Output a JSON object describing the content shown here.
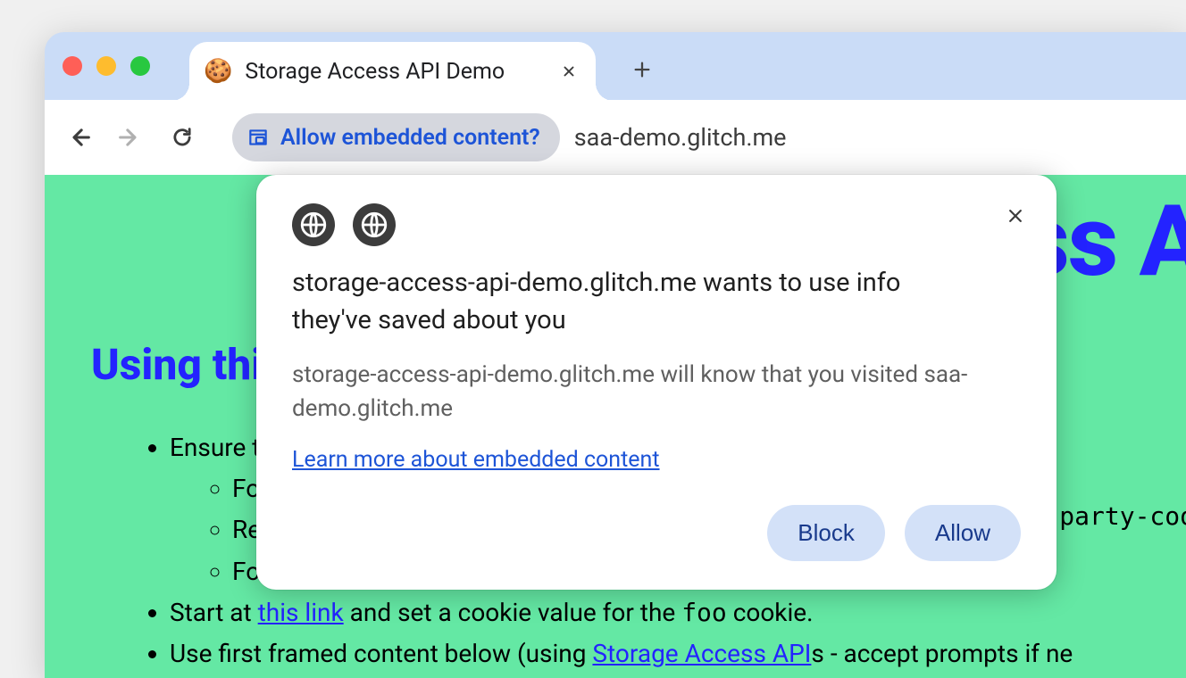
{
  "window": {
    "tab": {
      "favicon": "🍪",
      "title": "Storage Access API Demo"
    }
  },
  "toolbar": {
    "chip_label": "Allow embedded content?",
    "url": "saa-demo.glitch.me"
  },
  "page": {
    "hero_partial": "ss A",
    "heading": "Using this",
    "party_cookie_partial": "-party-coo",
    "bullets": {
      "b0": "Ensure t",
      "s0": "Fo",
      "s1": "Re",
      "s2": "Fo",
      "b1_pre": "Start at ",
      "b1_link": "this link",
      "b1_mid": " and set a cookie value for the ",
      "b1_code": "foo",
      "b1_post": " cookie.",
      "b2_pre": "Use first framed content below (using ",
      "b2_link": "Storage Access API",
      "b2_post": "s - accept prompts if ne"
    }
  },
  "popup": {
    "title": "storage-access-api-demo.glitch.me wants to use info they've saved about you",
    "desc": "storage-access-api-demo.glitch.me will know that you visited saa-demo.glitch.me",
    "learn_more": "Learn more about embedded content",
    "block": "Block",
    "allow": "Allow"
  }
}
